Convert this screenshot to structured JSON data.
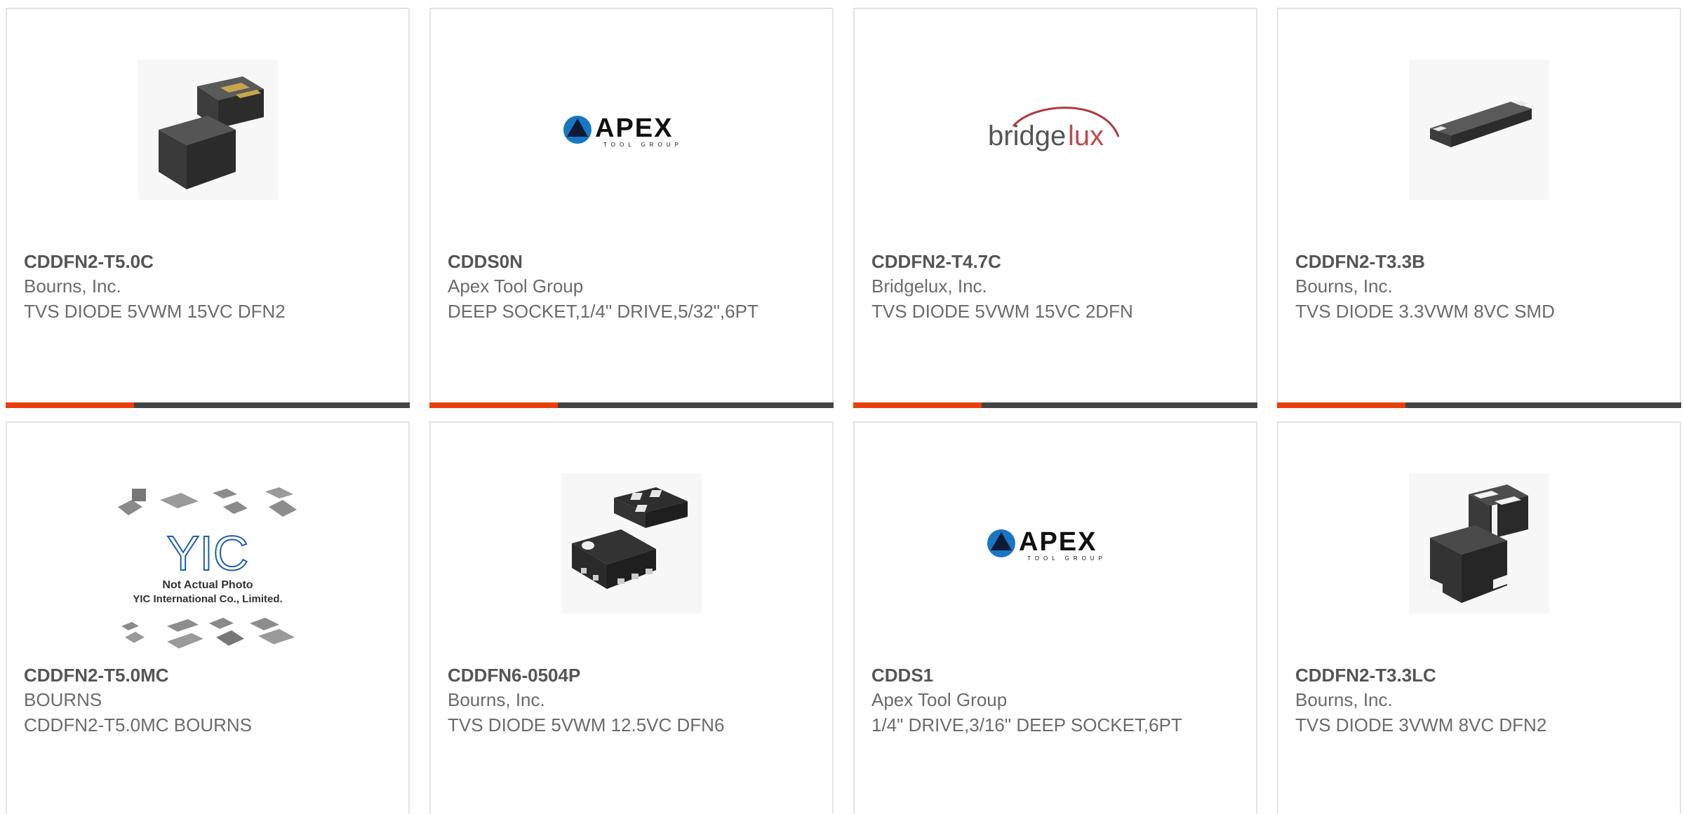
{
  "colors": {
    "accent": "#e8400c",
    "bar_dark": "#444444"
  },
  "products": [
    {
      "part_number": "CDDFN2-T5.0C",
      "manufacturer": "Bourns, Inc.",
      "description": "TVS DIODE 5VWM 15VC DFN2",
      "image_icon": "dfn2-package-icon"
    },
    {
      "part_number": "CDDS0N",
      "manufacturer": "Apex Tool Group",
      "description": "DEEP SOCKET,1/4\" DRIVE,5/32\",6PT",
      "image_icon": "apex-logo",
      "logo": {
        "main": "APEX",
        "sub": "TOOL GROUP"
      }
    },
    {
      "part_number": "CDDFN2-T4.7C",
      "manufacturer": "Bridgelux, Inc.",
      "description": "TVS DIODE 5VWM 15VC 2DFN",
      "image_icon": "bridgelux-logo",
      "logo": {
        "a": "bridge",
        "b": "lux"
      }
    },
    {
      "part_number": "CDDFN2-T3.3B",
      "manufacturer": "Bourns, Inc.",
      "description": "TVS DIODE 3.3VWM 8VC SMD",
      "image_icon": "smd-package-icon"
    },
    {
      "part_number": "CDDFN2-T5.0MC",
      "manufacturer": "BOURNS",
      "description": "CDDFN2-T5.0MC BOURNS",
      "image_icon": "not-actual-photo-icon",
      "placeholder": {
        "logo": "YIC",
        "line1": "Not Actual Photo",
        "line2": "YIC International Co., Limited."
      }
    },
    {
      "part_number": "CDDFN6-0504P",
      "manufacturer": "Bourns, Inc.",
      "description": "TVS DIODE 5VWM 12.5VC DFN6",
      "image_icon": "dfn6-package-icon"
    },
    {
      "part_number": "CDDS1",
      "manufacturer": "Apex Tool Group",
      "description": "1/4\" DRIVE,3/16\" DEEP SOCKET,6PT",
      "image_icon": "apex-logo",
      "logo": {
        "main": "APEX",
        "sub": "TOOL GROUP"
      }
    },
    {
      "part_number": "CDDFN2-T3.3LC",
      "manufacturer": "Bourns, Inc.",
      "description": "TVS DIODE 3VWM 8VC DFN2",
      "image_icon": "dfn2-package-icon"
    }
  ]
}
